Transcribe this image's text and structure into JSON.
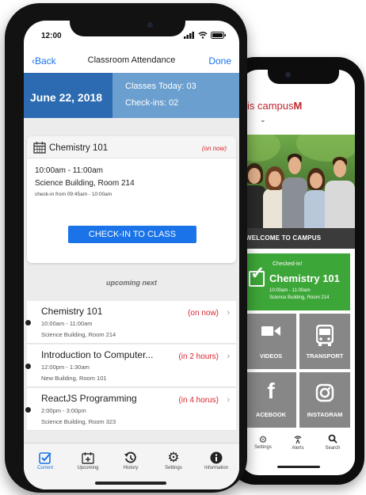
{
  "back_app": {
    "logo_prefix": "is campus",
    "logo_suffix": "M",
    "hero_caption": "WELCOME TO CAMPUS",
    "checked_in": {
      "label": "Checked-in!",
      "class_name": "Chemistry 101",
      "time": "10:00am - 11:00am",
      "room": "Science Building, Room 214"
    },
    "tiles": [
      {
        "label": "VIDEOS",
        "icon": "video-camera-icon"
      },
      {
        "label": "TRANSPORT",
        "icon": "bus-icon"
      },
      {
        "label": "ACEBOOK",
        "icon": "facebook-icon"
      },
      {
        "label": "INSTAGRAM",
        "icon": "instagram-icon"
      }
    ],
    "tabs": [
      {
        "label": "Settings",
        "icon": "gear-icon"
      },
      {
        "label": "Alerts",
        "icon": "broadcast-icon"
      },
      {
        "label": "Search",
        "icon": "search-icon"
      }
    ]
  },
  "front_app": {
    "status_time": "12:00",
    "nav": {
      "back_label": "Back",
      "title": "Classroom Attendance",
      "done_label": "Done"
    },
    "summary": {
      "date": "June 22, 2018",
      "classes_today": "Classes Today: 03",
      "checkins": "Check-ins: 02"
    },
    "current_class": {
      "name": "Chemistry 101",
      "badge": "(on now)",
      "time": "10:00am - 11:00am",
      "room": "Science Building, Room 214",
      "checkin_window": "check-in from 09:45am - 10:00am",
      "button_label": "CHECK-IN TO CLASS"
    },
    "upcoming_label": "upcoming next",
    "upcoming": [
      {
        "name": "Chemistry 101",
        "time": "10:00am - 11:00am",
        "room": "Science Building, Room 214",
        "when": "(on now)"
      },
      {
        "name": "Introduction to Computer...",
        "time": "12:00pm - 1:30am",
        "room": "New Building, Room 101",
        "when": "(in 2 hours)"
      },
      {
        "name": "ReactJS Programming",
        "time": "2:00pm - 3:00pm",
        "room": "Science Building, Room 323",
        "when": "(in 4 horus)"
      }
    ],
    "tabs": [
      {
        "label": "Current",
        "icon": "checkbox-icon",
        "active": true
      },
      {
        "label": "Upcoming",
        "icon": "calendar-plus-icon",
        "active": false
      },
      {
        "label": "History",
        "icon": "history-icon",
        "active": false
      },
      {
        "label": "Settings",
        "icon": "gear-icon",
        "active": false
      },
      {
        "label": "Information",
        "icon": "info-icon",
        "active": false
      }
    ]
  },
  "colors": {
    "accent_blue": "#1a73e8",
    "summary_dark": "#2c6bb1",
    "summary_light": "#6a9fcf",
    "alert_red": "#d9232d",
    "checked_green": "#3da638",
    "tile_gray": "#878787"
  }
}
